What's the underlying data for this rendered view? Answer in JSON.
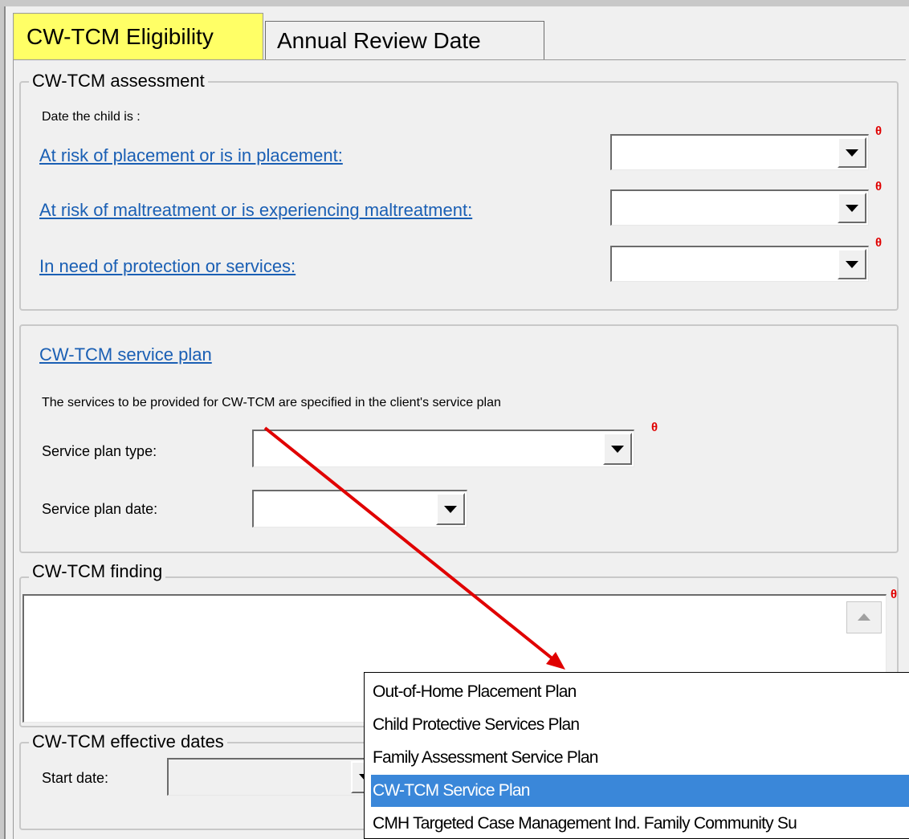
{
  "tabs": [
    {
      "label": "CW-TCM Eligibility",
      "active": true
    },
    {
      "label": "Annual Review Date",
      "active": false
    }
  ],
  "assessment": {
    "legend": "CW-TCM assessment",
    "intro": "Date the child is :",
    "rows": [
      {
        "label": "At risk of placement or is in placement:",
        "value": "",
        "required_mark": "θ"
      },
      {
        "label": "At risk of maltreatment or is experiencing maltreatment:",
        "value": "",
        "required_mark": "θ"
      },
      {
        "label": "In need of protection or services:",
        "value": "",
        "required_mark": "θ"
      }
    ]
  },
  "service_plan": {
    "title": "CW-TCM service plan",
    "description": "The services to be provided for CW-TCM are specified in the client's service plan",
    "type_label": "Service plan type:",
    "type_value": "",
    "type_required_mark": "θ",
    "date_label": "Service plan date:",
    "date_value": ""
  },
  "finding": {
    "legend": "CW-TCM finding",
    "value": "",
    "required_mark": "θ"
  },
  "effective_dates": {
    "legend": "CW-TCM effective dates",
    "start_label": "Start date:",
    "start_value": ""
  },
  "dropdown": {
    "options": [
      "Out-of-Home Placement Plan",
      "Child Protective Services Plan",
      "Family Assessment Service Plan",
      "CW-TCM Service Plan",
      "CMH Targeted Case Management Ind. Family Community Su"
    ],
    "selected_index": 3
  },
  "colors": {
    "active_tab": "#ffff66",
    "link": "#1a5fb4",
    "required": "#e00000",
    "selection": "#3a87d9",
    "annotation_arrow": "#e00000"
  }
}
